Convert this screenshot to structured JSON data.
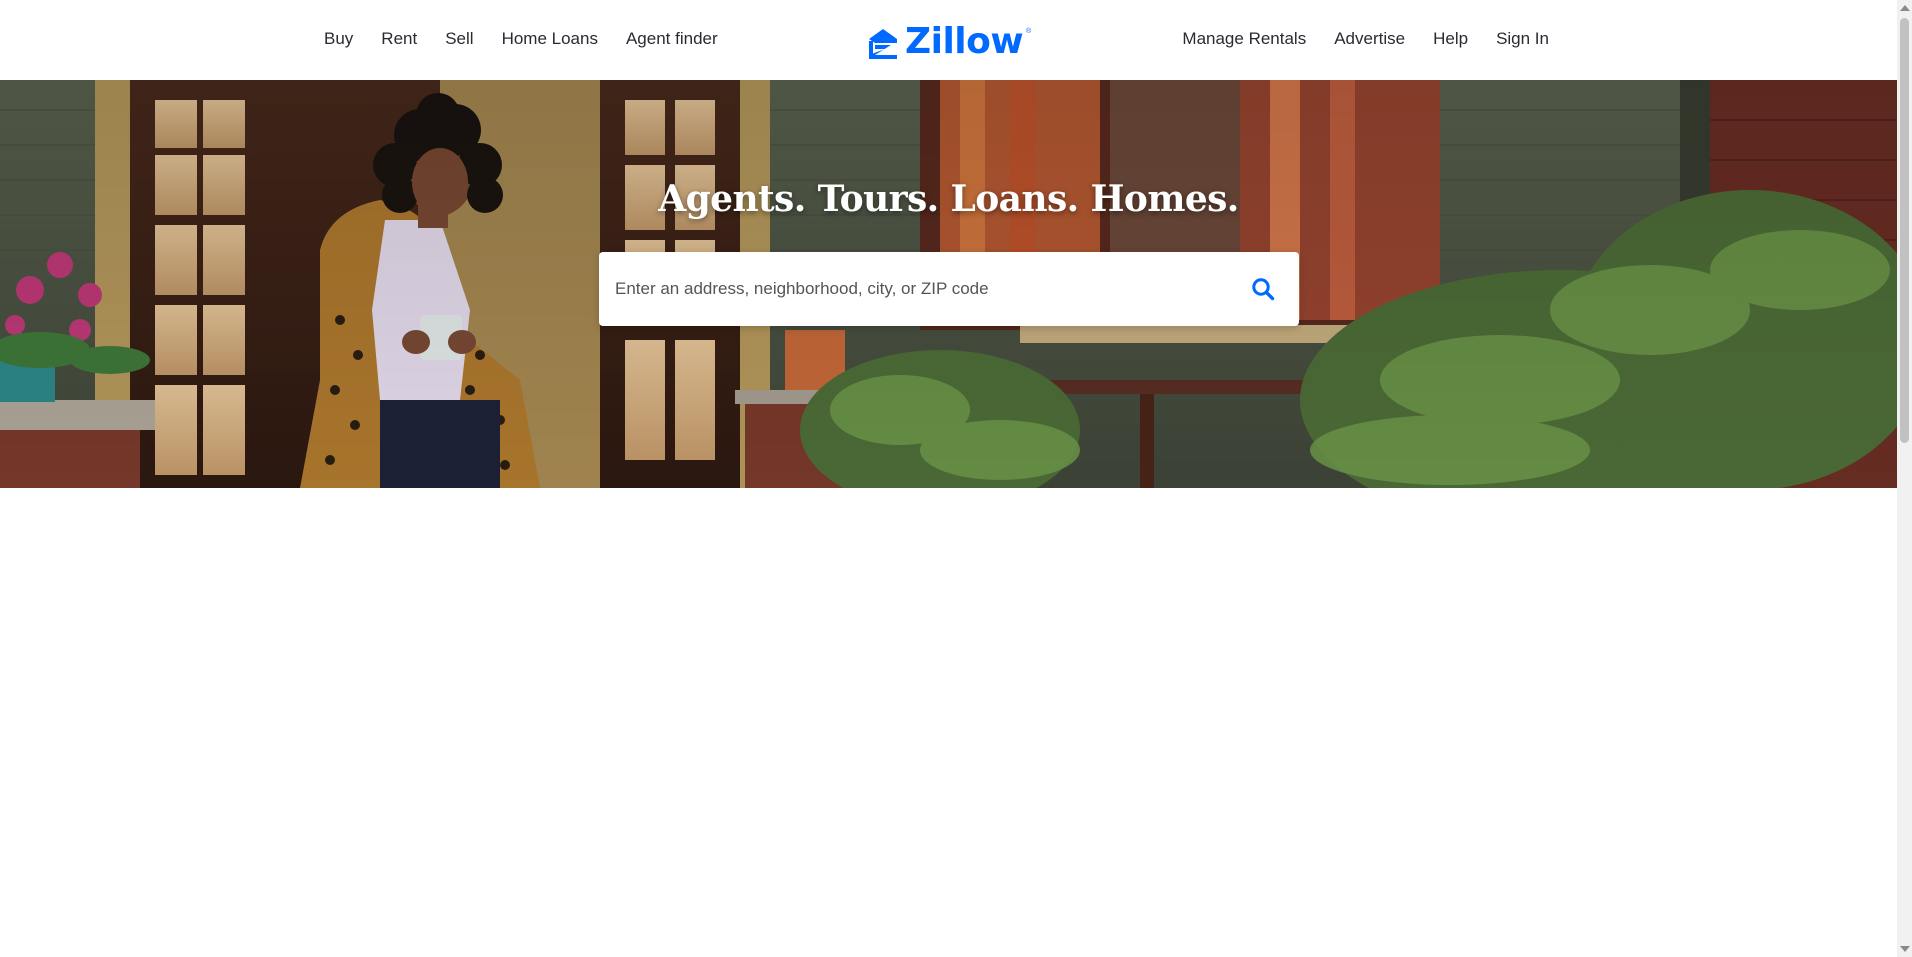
{
  "nav": {
    "left": [
      {
        "label": "Buy"
      },
      {
        "label": "Rent"
      },
      {
        "label": "Sell"
      },
      {
        "label": "Home Loans"
      },
      {
        "label": "Agent finder"
      }
    ],
    "right": [
      {
        "label": "Manage Rentals"
      },
      {
        "label": "Advertise"
      },
      {
        "label": "Help"
      },
      {
        "label": "Sign In"
      }
    ]
  },
  "logo": {
    "text": "Zillow",
    "icon": "zillow-house-icon",
    "color": "#006aff"
  },
  "hero": {
    "heading": "Agents. Tours. Loans. Homes.",
    "image": "woman-on-porch-photo"
  },
  "search": {
    "placeholder": "Enter an address, neighborhood, city, or ZIP code",
    "value": "",
    "icon": "search-icon"
  },
  "colors": {
    "brand": "#006aff",
    "text": "#2a2a33"
  }
}
